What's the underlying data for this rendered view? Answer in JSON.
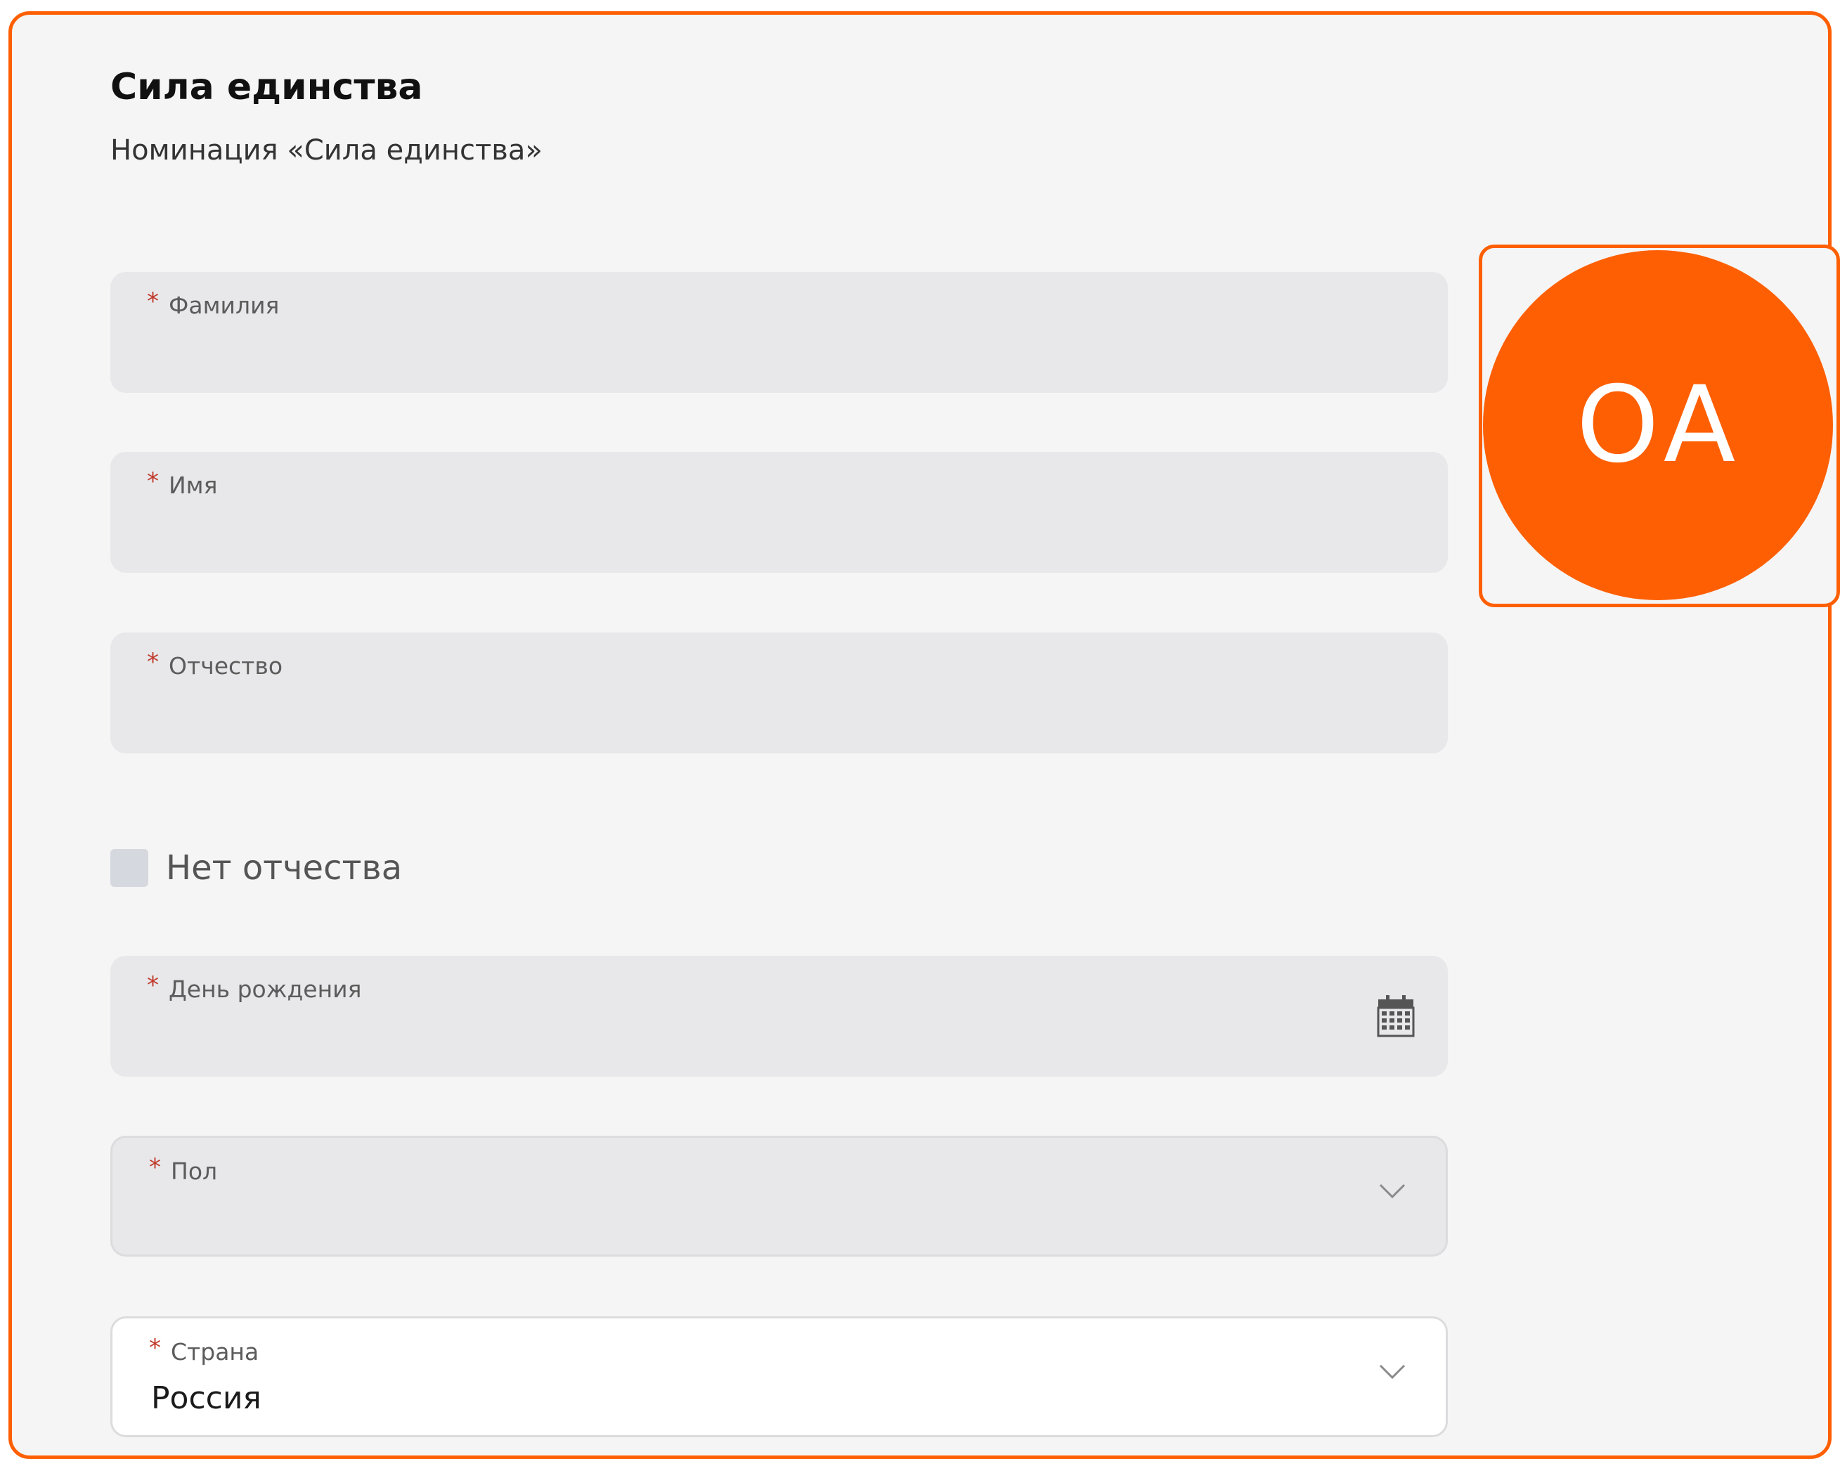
{
  "form": {
    "title": "Сила единства",
    "subtitle": "Номинация «Сила единства»",
    "required_mark": "*",
    "fields": {
      "last_name": {
        "label": "Фамилия",
        "value": ""
      },
      "first_name": {
        "label": "Имя",
        "value": ""
      },
      "patronymic": {
        "label": "Отчество",
        "value": ""
      },
      "birthday": {
        "label": "День рождения",
        "value": "",
        "icon": "calendar-icon"
      },
      "gender": {
        "label": "Пол",
        "value": "",
        "icon": "chevron-down-icon"
      },
      "country": {
        "label": "Страна",
        "value": "Россия",
        "icon": "chevron-down-icon"
      }
    },
    "no_patronymic": {
      "label": "Нет отчества",
      "checked": false
    }
  },
  "avatar": {
    "initials": "ОА"
  },
  "colors": {
    "accent": "#fe5f03",
    "background": "#f5f5f5",
    "field_background": "#e8e8ea",
    "required": "#c0392b"
  }
}
